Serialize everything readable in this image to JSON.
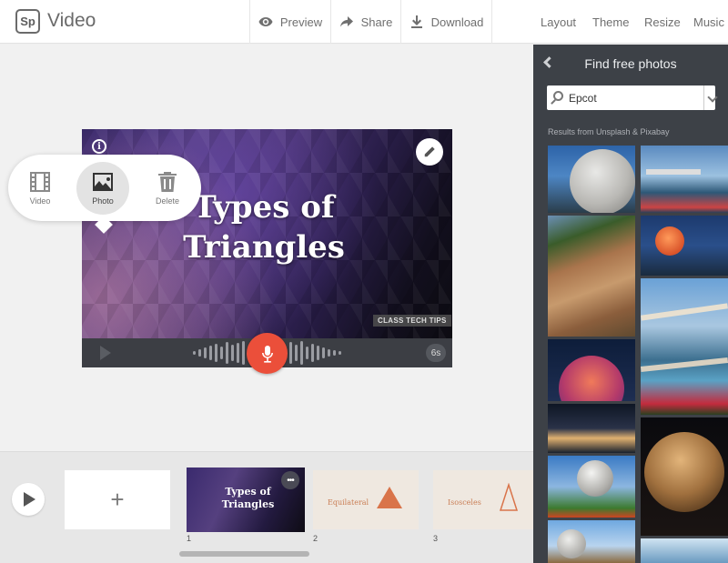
{
  "app": {
    "logo": "Sp",
    "name": "Video"
  },
  "toolbar": {
    "preview": "Preview",
    "share": "Share",
    "download": "Download",
    "layout": "Layout",
    "theme": "Theme",
    "resize": "Resize",
    "music": "Music"
  },
  "slide": {
    "title_line1": "Types of",
    "title_line2": "Triangles",
    "watermark": "CLASS TECH TIPS",
    "duration": "6s"
  },
  "media_popup": {
    "video": "Video",
    "photo": "Photo",
    "delete": "Delete",
    "active": "Photo"
  },
  "timeline": {
    "add": "+",
    "slides": [
      {
        "number": "1",
        "title_line1": "Types of",
        "title_line2": "Triangles",
        "more": "•••"
      },
      {
        "number": "2",
        "label": "Equilateral"
      },
      {
        "number": "3",
        "label": "Isosceles"
      }
    ]
  },
  "photo_panel": {
    "title": "Find free photos",
    "search_value": "Epcot",
    "results_label": "Results from Unsplash & Pixabay"
  },
  "colors": {
    "accent_red": "#eb4f3a",
    "panel_bg": "#3d4147",
    "triangle_orange": "#d9744a"
  }
}
